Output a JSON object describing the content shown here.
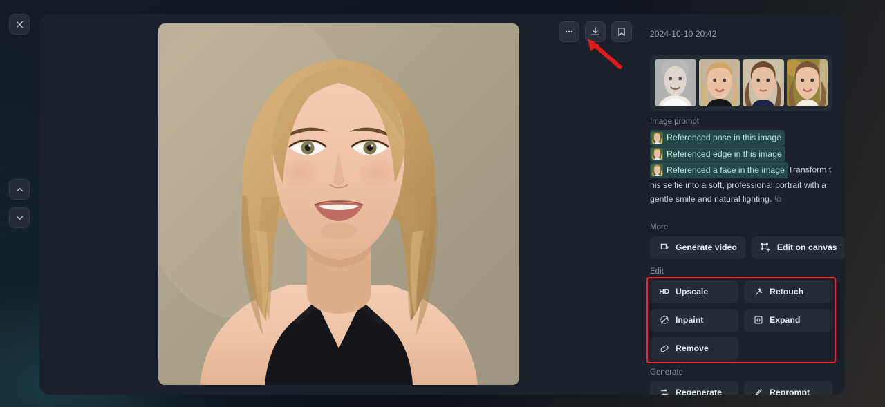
{
  "left_rail": {
    "close_label": "Close",
    "prev_label": "Previous",
    "next_label": "Next"
  },
  "toolbar": {
    "more_label": "More options",
    "download_label": "Download",
    "bookmark_label": "Bookmark"
  },
  "side": {
    "timestamp": "2024-10-10 20:42",
    "references": [
      {
        "alt": "reference-thumbnail-1"
      },
      {
        "alt": "reference-thumbnail-2"
      },
      {
        "alt": "reference-thumbnail-3"
      },
      {
        "alt": "reference-thumbnail-4"
      }
    ],
    "prompt": {
      "label": "Image prompt",
      "tags": [
        "Referenced pose in this image",
        "Referenced edge in this image",
        "Referenced a face in the image"
      ],
      "body": "Transform this selfie into a soft, professional portrait with a gentle smile and natural lighting.",
      "copy_icon": "copy-icon"
    },
    "sections": {
      "more": {
        "title": "More",
        "buttons": [
          {
            "label": "Generate video",
            "icon": "video-frame-plus-icon"
          },
          {
            "label": "Edit on canvas",
            "icon": "canvas-crop-icon"
          }
        ]
      },
      "edit": {
        "title": "Edit",
        "buttons": [
          {
            "label": "Upscale",
            "icon": "hd-icon"
          },
          {
            "label": "Retouch",
            "icon": "magic-wand-icon"
          },
          {
            "label": "Inpaint",
            "icon": "paint-brush-icon"
          },
          {
            "label": "Expand",
            "icon": "expand-icon"
          },
          {
            "label": "Remove",
            "icon": "eraser-icon"
          }
        ]
      },
      "generate": {
        "title": "Generate",
        "buttons": [
          {
            "label": "Regenerate",
            "icon": "refresh-arrows-icon"
          },
          {
            "label": "Reprompt",
            "icon": "pencil-icon"
          }
        ]
      }
    }
  },
  "stage": {
    "image_alt": "generated-portrait-of-blonde-woman"
  },
  "annotations": {
    "highlight_color": "#ef2b2b",
    "arrow_color": "#e01b1b",
    "arrow_target": "download-button",
    "highlight_target": "edit-section"
  }
}
